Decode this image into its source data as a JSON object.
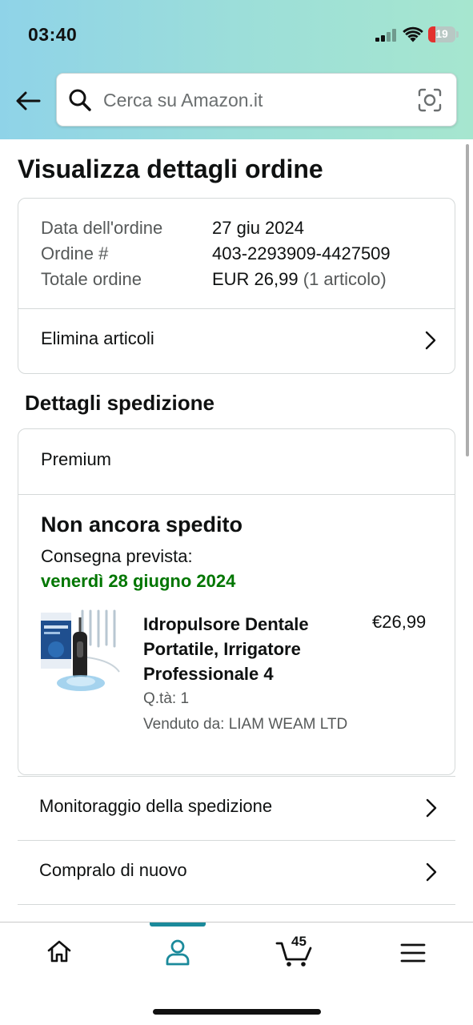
{
  "status_bar": {
    "time": "03:40",
    "battery": "19"
  },
  "search": {
    "placeholder": "Cerca su Amazon.it"
  },
  "page": {
    "title": "Visualizza dettagli ordine"
  },
  "order_summary": {
    "date_label": "Data dell'ordine",
    "date_value": "27 giu 2024",
    "number_label": "Ordine #",
    "number_value": "403-2293909-4427509",
    "total_label": "Totale ordine",
    "total_value": "EUR 26,99",
    "total_items": "(1 articolo)",
    "delete_items_label": "Elimina articoli"
  },
  "shipping": {
    "section_title": "Dettagli spedizione",
    "service": "Premium",
    "status": "Non ancora spedito",
    "delivery_label": "Consegna prevista:",
    "delivery_date": "venerdì 28 giugno 2024",
    "product": {
      "title": "Idropulsore Dentale Portatile, Irrigatore Professionale 4",
      "price": "€26,99",
      "quantity": "Q.tà: 1",
      "seller": "Venduto da: LIAM WEAM LTD"
    }
  },
  "actions": {
    "track_label": "Monitoraggio della spedizione",
    "buy_again_label": "Compralo di nuovo"
  },
  "tabbar": {
    "cart_count": "45",
    "active_tab": "account",
    "accent_color": "#1b8a9b"
  },
  "colors": {
    "delivery_green": "#007600",
    "header_gradient": [
      "#8fd3e8",
      "#a6e6cf"
    ]
  }
}
